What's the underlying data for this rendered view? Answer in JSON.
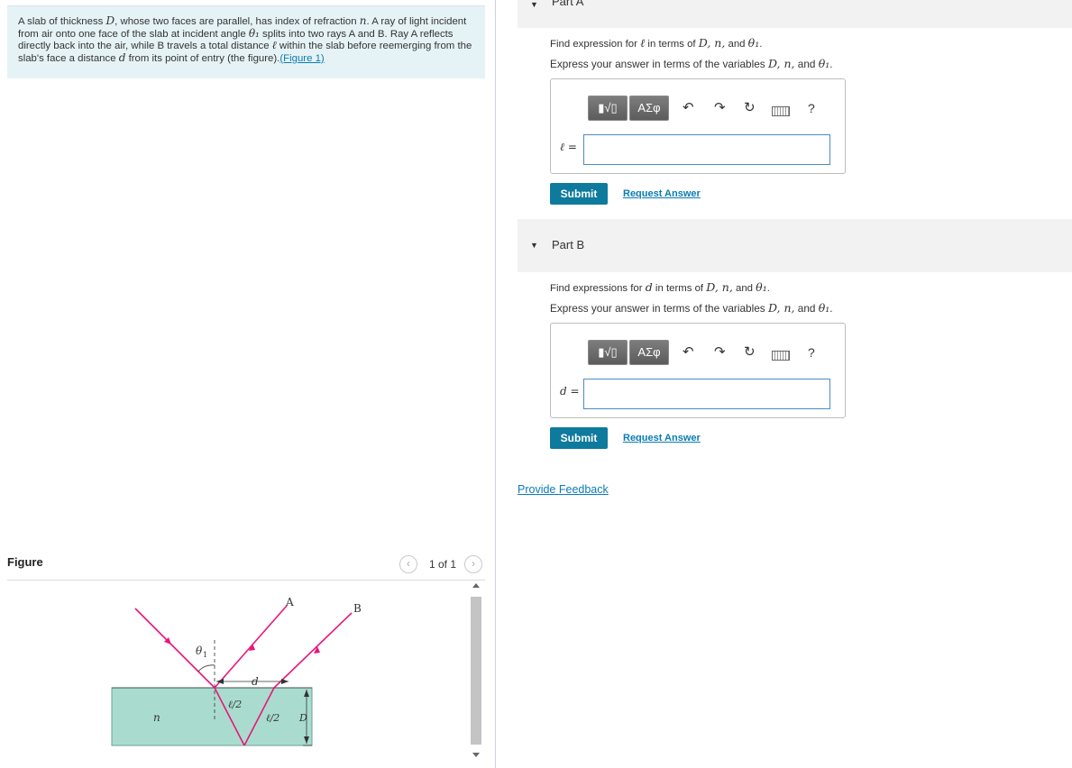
{
  "problem": {
    "text_1": "A slab of thickness ",
    "var_D": "D",
    "text_2": ", whose two faces are parallel, has index of refraction ",
    "var_n": "n",
    "text_3": ". A ray of light incident from air onto one face of the slab at incident angle ",
    "var_theta": "θ₁",
    "text_4": " splits into two rays A and B. Ray A reflects directly back into the air, while B travels a total distance ",
    "var_l": "ℓ",
    "text_5": " within the slab before reemerging from the slab's face a distance ",
    "var_d": "d",
    "text_6": " from its point of entry (the figure).",
    "figure_link": "(Figure 1)"
  },
  "figure_panel": {
    "title": "Figure",
    "pager_text": "1 of 1",
    "prev_icon": "chevron-left-icon",
    "next_icon": "chevron-right-icon",
    "labels": {
      "A": "A",
      "B": "B",
      "theta": "θ",
      "theta_sub": "1",
      "d": "d",
      "l2_left": "ℓ/2",
      "l2_right": "ℓ/2",
      "D": "D",
      "n": "n"
    },
    "colors": {
      "ray": "#e8167b",
      "slab": "#a9dccf",
      "slab_edge": "#6a9f96"
    }
  },
  "parts": [
    {
      "label": "Part A",
      "prompt": {
        "pre": "Find expression for ",
        "var": "ℓ",
        "post": " in terms of ",
        "vars": "D, n,",
        "and": " and ",
        "last": "θ₁",
        "end": "."
      },
      "instruction": {
        "pre": "Express your answer in terms of the variables ",
        "vars": "D, n,",
        "and": " and ",
        "last": "θ₁",
        "end": "."
      },
      "answer_label": "ℓ =",
      "answer_value": "",
      "toolbar": {
        "template_btn": "▮√▯",
        "greek_btn": "ΑΣφ",
        "undo_icon": "undo-icon",
        "redo_icon": "redo-icon",
        "reset_icon": "reset-icon",
        "keyboard_icon": "keyboard-icon",
        "help": "?"
      },
      "submit": "Submit",
      "request": "Request Answer"
    },
    {
      "label": "Part B",
      "prompt": {
        "pre": "Find expressions for ",
        "var": "d",
        "post": " in terms of ",
        "vars": "D, n,",
        "and": " and ",
        "last": "θ₁",
        "end": "."
      },
      "instruction": {
        "pre": "Express your answer in terms of the variables ",
        "vars": "D, n,",
        "and": " and ",
        "last": "θ₁",
        "end": "."
      },
      "answer_label": "d =",
      "answer_value": "",
      "toolbar": {
        "template_btn": "▮√▯",
        "greek_btn": "ΑΣφ",
        "undo_icon": "undo-icon",
        "redo_icon": "redo-icon",
        "reset_icon": "reset-icon",
        "keyboard_icon": "keyboard-icon",
        "help": "?"
      },
      "submit": "Submit",
      "request": "Request Answer"
    }
  ],
  "feedback": "Provide Feedback",
  "colors": {
    "accent": "#0e7a9d",
    "link": "#0b7cb3",
    "problem_bg": "#e6f3f6"
  }
}
